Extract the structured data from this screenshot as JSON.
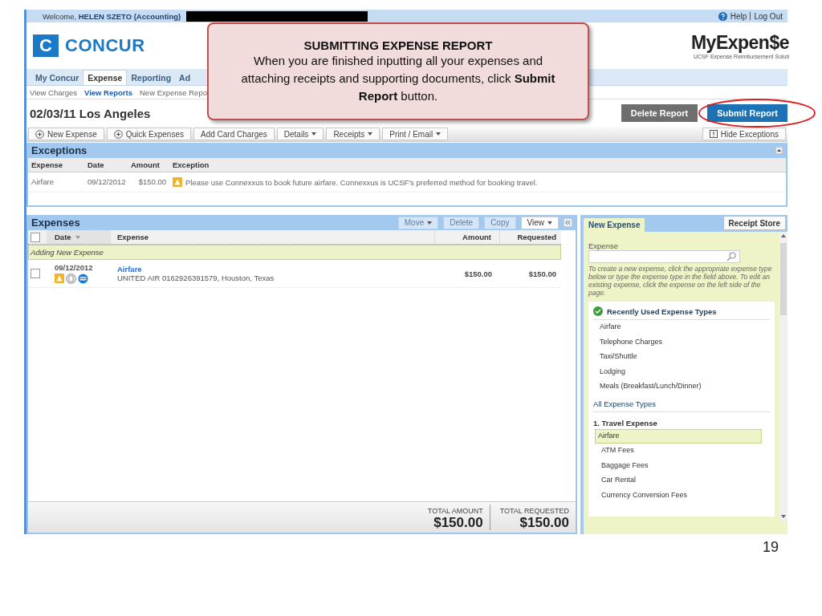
{
  "top_bar": {
    "welcome": "Welcome, **HELEN SZETO (Accounting)**",
    "links": [
      "Help",
      "Log Out"
    ]
  },
  "header": {
    "logo_mark": "C",
    "logo_text": "CONCUR",
    "brand": "MyExpen$e",
    "brand_subtitle": "UCSF Expense Reimbursement Soluti"
  },
  "nav_tabs": [
    {
      "label": "My Concur",
      "selected": false
    },
    {
      "label": "Expense",
      "selected": true
    },
    {
      "label": "Reporting",
      "selected": false
    },
    {
      "label": "Ad",
      "selected": false
    }
  ],
  "sub_nav": [
    {
      "label": "View Charges",
      "selected": false
    },
    {
      "label": "View Reports",
      "selected": true
    },
    {
      "label": "New Expense Repo",
      "selected": false
    }
  ],
  "report": {
    "title": "02/03/11 Los Angeles",
    "actions": [
      {
        "label": "Delete Report",
        "kind": "secondary"
      },
      {
        "label": "Submit Report",
        "kind": "primary"
      }
    ]
  },
  "toolbar": [
    {
      "label": "New Expense",
      "kind": "add"
    },
    {
      "label": "Quick Expenses",
      "kind": "add"
    },
    {
      "label": "Add Card Charges",
      "kind": "plain"
    },
    {
      "label": "Details",
      "kind": "menu"
    },
    {
      "label": "Receipts",
      "kind": "menu"
    },
    {
      "label": "Print / Email",
      "kind": "menu"
    }
  ],
  "hide_exceptions": "Hide Exceptions",
  "exceptions": {
    "title": "Exceptions",
    "columns": [
      "Expense",
      "Date",
      "Amount",
      "Exception"
    ],
    "rows": [
      {
        "expense": "Airfare",
        "date": "09/12/2012",
        "amount": "$150.00",
        "exception": "Please use Connexxus to book future airfare. Connexxus is UCSF's preferred method for booking travel."
      }
    ]
  },
  "expenses": {
    "title": "Expenses",
    "buttons": [
      {
        "label": "Move",
        "kind": "menu",
        "disabled": true
      },
      {
        "label": "Delete",
        "kind": "plain",
        "disabled": true
      },
      {
        "label": "Copy",
        "kind": "plain",
        "disabled": true
      },
      {
        "label": "View",
        "kind": "menu",
        "disabled": false
      }
    ],
    "select_all_checked": false,
    "columns": [
      "Date",
      "Expense",
      "Amount",
      "Requested"
    ],
    "group": "Adding New Expense",
    "rows": [
      {
        "checked": false,
        "date": "09/12/2012",
        "type": "Airfare",
        "vendor": "UNITED AIR 0162926391579, Houston, Texas",
        "amount": "$150.00",
        "requested": "$150.00"
      }
    ],
    "totals": [
      {
        "label": "TOTAL AMOUNT",
        "value": "$150.00"
      },
      {
        "label": "TOTAL REQUESTED",
        "value": "$150.00"
      }
    ]
  },
  "side_panel": {
    "tab": {
      "label": "New Expense",
      "selected": true
    },
    "button": "Receipt Store",
    "field_label": "Expense",
    "hint": "To create a new expense, click the appropriate expense type below or type the expense type in the field above. To edit an existing expense, click the expense on the left side of the page.",
    "recent_title": "Recently Used Expense Types",
    "recent": [
      "Airfare",
      "Telephone Charges",
      "Taxi/Shuttle",
      "Lodging",
      "Meals (Breakfast/Lunch/Dinner)"
    ],
    "all_title": "All Expense Types",
    "category": "1. Travel Expense",
    "types": [
      {
        "label": "Airfare",
        "selected": true
      },
      {
        "label": "ATM Fees",
        "selected": false
      },
      {
        "label": "Baggage Fees",
        "selected": false
      },
      {
        "label": "Car Rental",
        "selected": false
      },
      {
        "label": "Currency Conversion Fees",
        "selected": false
      }
    ]
  },
  "callout": {
    "title": "SUBMITTING EXPENSE REPORT",
    "text": "When you are finished inputting all your expenses and attaching receipts and supporting documents, click **Submit Report** button."
  },
  "slide_number": "19"
}
